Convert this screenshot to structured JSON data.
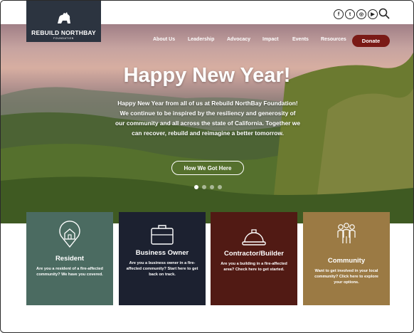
{
  "brand": {
    "name": "REBUILD NORTHBAY",
    "tagline": "FOUNDATION"
  },
  "social": [
    {
      "icon": "facebook-icon",
      "glyph": "f"
    },
    {
      "icon": "twitter-icon",
      "glyph": "t"
    },
    {
      "icon": "instagram-icon",
      "glyph": "◎"
    },
    {
      "icon": "youtube-icon",
      "glyph": "▶"
    }
  ],
  "nav": {
    "items": [
      "About Us",
      "Leadership",
      "Advocacy",
      "Impact",
      "Events",
      "Resources"
    ],
    "donate": "Donate"
  },
  "hero": {
    "title": "Happy New Year!",
    "text": "Happy New Year from all of us at Rebuild NorthBay Foundation! We continue to be inspired by the resiliency and generosity of our community and all across the state of California. Together we can recover, rebuild and reimagine a better tomorrow.",
    "button": "How We Got Here",
    "slides": 4,
    "active_slide": 1
  },
  "cards": [
    {
      "title": "Resident",
      "text": "Are you a resident of a fire-affected community? We have you covered.",
      "color": "#4b6b61",
      "icon": "house-pin-icon"
    },
    {
      "title": "Business Owner",
      "text": "Are you a business owner in a fire-affected community? Start here to get back on track.",
      "color": "#1c2130",
      "icon": "briefcase-icon"
    },
    {
      "title": "Contractor/Builder",
      "text": "Are you a building in a fire-affected area? Check here to get started.",
      "color": "#511a14",
      "icon": "hard-hat-icon"
    },
    {
      "title": "Community",
      "text": "Want to get involved in your local community? Click here to explore your options.",
      "color": "#9b7a44",
      "icon": "people-icon"
    }
  ],
  "colors": {
    "logo_bg": "#2c3440",
    "donate": "#7a1a16"
  }
}
